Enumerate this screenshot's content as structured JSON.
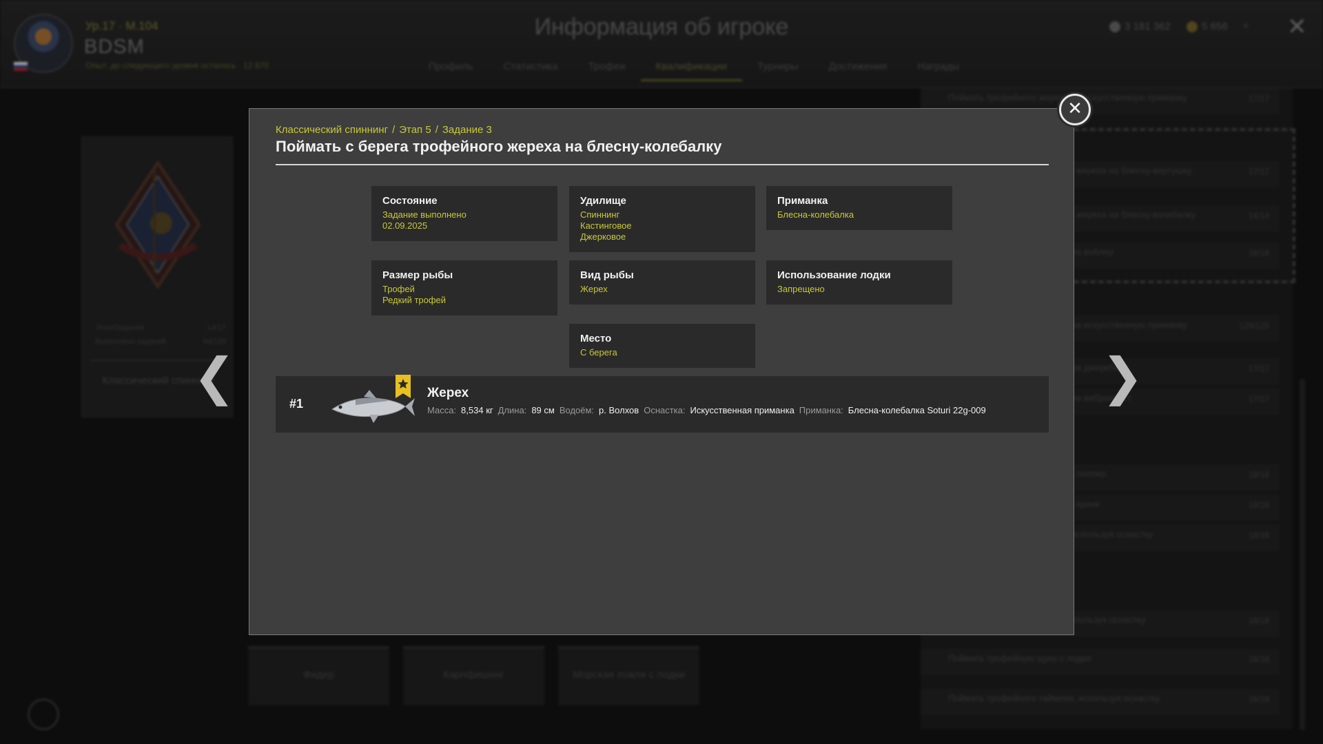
{
  "header": {
    "title": "Информация об игроке",
    "level_line": "Ур.17 · М.104",
    "player_name": "BDSM",
    "exp_line": "Опыт: до следующего уровня осталось · 12 870",
    "tabs": [
      {
        "label": "Профиль"
      },
      {
        "label": "Статистика"
      },
      {
        "label": "Трофеи"
      },
      {
        "label": "Квалификации"
      },
      {
        "label": "Турниры"
      },
      {
        "label": "Достижения"
      },
      {
        "label": "Награды"
      }
    ],
    "silver": "3 181 362",
    "gold": "5 656",
    "plus": "+",
    "close_glyph": "✕"
  },
  "background": {
    "left_card": {
      "rows": [
        {
          "label": "Этап/Задание",
          "value": "14/17"
        },
        {
          "label": "Выполнено заданий",
          "value": "94/130"
        }
      ],
      "category": "Классический спиннинг"
    },
    "bottom_tiles": [
      "Фидер",
      "Карпфишинг",
      "Морская ловля с лодки"
    ],
    "right_rows": [
      {
        "text": "Поймать трофейного жереха на искусственную приманку",
        "value": "17/17"
      },
      {
        "text": "Поймать с берега трофейного жереха на блесну-вертушку",
        "value": "17/17"
      },
      {
        "text": "Поймать с берега трофейного жереха на блесну-колебалку",
        "value": "14/14"
      },
      {
        "text": "Поймать трофейного жереха на воблер",
        "value": "18/18"
      },
      {
        "text": "Поймать трофейного жереха на искусственную приманку",
        "value": "125/125"
      },
      {
        "text": "Поймать трофейного жереха на джеркбейт",
        "value": "17/17"
      },
      {
        "text": "Поймать трофейного жереха на виброхвост",
        "value": "17/17"
      },
      {
        "text": "Поймать трофейного окуня на поппер",
        "value": "18/18"
      },
      {
        "text": "Поймать трофейного окуня на кренк",
        "value": "18/18"
      },
      {
        "text": "Поймать трофейного судака, используя оснастку",
        "value": "18/18"
      },
      {
        "text": "Поймать трофейного сома, используя оснастку",
        "value": "18/18"
      },
      {
        "text": "Поймать трофейную щуку с лодки",
        "value": "18/18"
      },
      {
        "text": "Поймать трофейного тайменя, используя оснастку",
        "value": "18/18"
      }
    ]
  },
  "nav": {
    "prev_glyph": "❮",
    "next_glyph": "❯"
  },
  "modal": {
    "close_glyph": "✕",
    "breadcrumb": [
      "Классический спиннинг",
      "Этап 5",
      "Задание 3"
    ],
    "breadcrumb_sep": "/",
    "title": "Поймать с берега трофейного жереха на блесну-колебалку",
    "conditions": {
      "state": {
        "title": "Состояние",
        "lines": [
          "Задание выполнено",
          "02.09.2025"
        ]
      },
      "rod": {
        "title": "Удилище",
        "lines": [
          "Спиннинг",
          "Кастинговое",
          "Джерковое"
        ]
      },
      "bait": {
        "title": "Приманка",
        "lines": [
          "Блесна-колебалка"
        ]
      },
      "size": {
        "title": "Размер рыбы",
        "lines": [
          "Трофей",
          "Редкий трофей"
        ]
      },
      "species": {
        "title": "Вид рыбы",
        "lines": [
          "Жерех"
        ]
      },
      "boat": {
        "title": "Использование лодки",
        "lines": [
          "Запрещено"
        ]
      },
      "place": {
        "title": "Место",
        "lines": [
          "С берега"
        ]
      }
    },
    "catch": {
      "rank": "#1",
      "fish": "Жерех",
      "details": [
        {
          "label": "Масса:",
          "value": "8,534 кг"
        },
        {
          "label": "Длина:",
          "value": "89 см"
        },
        {
          "label": "Водоём:",
          "value": "р. Волхов"
        },
        {
          "label": "Оснастка:",
          "value": "Искусственная приманка"
        },
        {
          "label": "Приманка:",
          "value": "Блесна-колебалка Soturi 22g-009"
        }
      ]
    }
  },
  "colors": {
    "accent_yellow": "#c9c936",
    "modal_bg": "#3e3e3e",
    "card_bg": "#2a2a2a",
    "text_white": "#f0f0f0",
    "trophy_flag": "#e8c020"
  }
}
